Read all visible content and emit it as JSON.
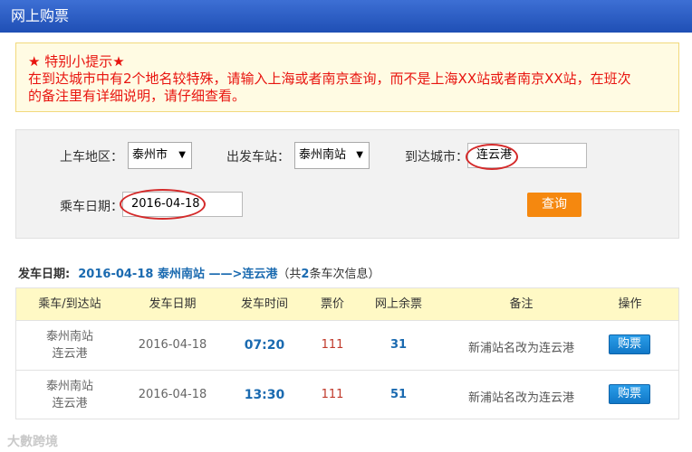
{
  "window": {
    "title": "网上购票"
  },
  "notice": {
    "heading": "★ 特别小提示★",
    "line1": "在到达城市中有2个地名较特殊，请输入上海或者南京查询，而不是上海XX站或者南京XX站，在班次",
    "line2": "的备注里有详细说明，请仔细查看。"
  },
  "search": {
    "region_label": "上车地区：",
    "region_value": "泰州市",
    "station_label": "出发车站：",
    "station_value": "泰州南站",
    "city_label": "到达城市：",
    "city_value": "连云港",
    "date_label": "乘车日期：",
    "date_value": "2016-04-18",
    "query_label": "查询"
  },
  "summary": {
    "prefix": "发车日期:",
    "date": "2016-04-18",
    "route": "泰州南站 ——>连云港",
    "count_pre": "（共",
    "count": "2",
    "count_post": "条车次信息）"
  },
  "table": {
    "headers": [
      "乘车/到达站",
      "发车日期",
      "发车时间",
      "票价",
      "网上余票",
      "备注",
      "操作"
    ],
    "rows": [
      {
        "from": "泰州南站",
        "to": "连云港",
        "date": "2016-04-18",
        "time": "07:20",
        "price": "111",
        "seats": "31",
        "remark": "新浦站名改为连云港",
        "action": "购票"
      },
      {
        "from": "泰州南站",
        "to": "连云港",
        "date": "2016-04-18",
        "time": "13:30",
        "price": "111",
        "seats": "51",
        "remark": "新浦站名改为连云港",
        "action": "购票"
      }
    ]
  },
  "watermark": {
    "text": "大數跨境"
  },
  "colors": {
    "titlebar": "#2556c4",
    "notice_text": "#e8140f",
    "query_button": "#f5880f",
    "buy_button": "#1a8ad8",
    "highlight_ring": "#d42a2a"
  }
}
